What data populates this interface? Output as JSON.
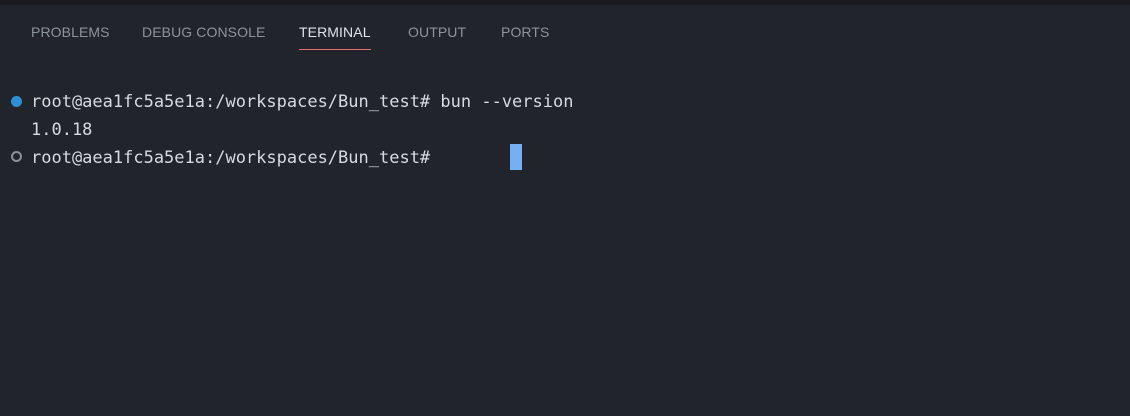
{
  "tabs": [
    {
      "label": "PROBLEMS",
      "active": false
    },
    {
      "label": "DEBUG CONSOLE",
      "active": false
    },
    {
      "label": "TERMINAL",
      "active": true
    },
    {
      "label": "OUTPUT",
      "active": false
    },
    {
      "label": "PORTS",
      "active": false
    }
  ],
  "terminal": {
    "lines": [
      {
        "prompt": "root@aea1fc5a5e1a:/workspaces/Bun_test#",
        "command": " bun --version",
        "decoration": "success-circle"
      },
      {
        "output": "1.0.18"
      },
      {
        "prompt": "root@aea1fc5a5e1a:/workspaces/Bun_test#",
        "command": " ",
        "decoration": "default-circle"
      }
    ]
  },
  "colors": {
    "background": "#21252b",
    "active_tab_underline": "#e06c75",
    "cursor": "#74b0f4",
    "success_decoration": "#2f8fd6"
  }
}
